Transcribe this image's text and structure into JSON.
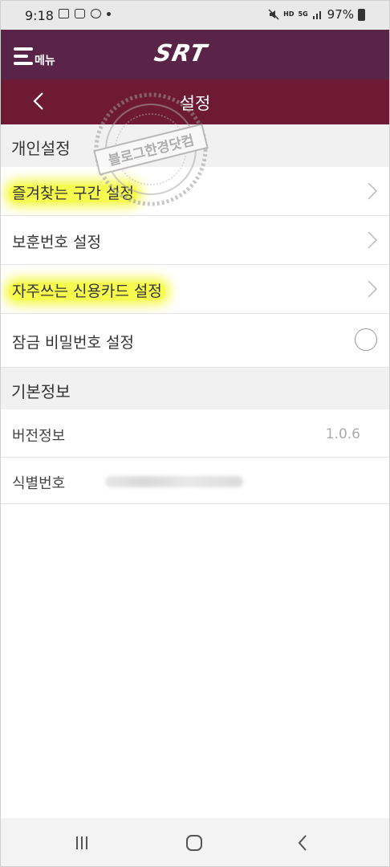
{
  "status_bar": {
    "time": "9:18",
    "hd_label": "HD",
    "lte_label": "5G",
    "battery_percent": "97%"
  },
  "app_header": {
    "menu_label": "메뉴",
    "logo_text": "SRT",
    "brand_color": "#5a2448"
  },
  "title_bar": {
    "title": "설정",
    "color": "#6e1a35"
  },
  "watermark": {
    "text": "블로그한경닷컴"
  },
  "personal": {
    "header": "개인설정",
    "items": [
      {
        "label": "즐겨찾는 구간 설정",
        "highlighted": true,
        "control": "chevron-right-icon"
      },
      {
        "label": "보훈번호 설정",
        "highlighted": false,
        "control": "chevron-right-icon"
      },
      {
        "label": "자주쓰는 신용카드 설정",
        "highlighted": true,
        "control": "chevron-right-icon"
      },
      {
        "label": "잠금 비밀번호 설정",
        "highlighted": false,
        "control": "toggle-circle",
        "checked": false
      }
    ]
  },
  "basic": {
    "header": "기본정보",
    "version_label": "버전정보",
    "version_value": "1.0.6",
    "id_label": "식별번호"
  },
  "nav_bar": {
    "icons": [
      "recent-apps-icon",
      "home-icon",
      "back-icon"
    ]
  }
}
